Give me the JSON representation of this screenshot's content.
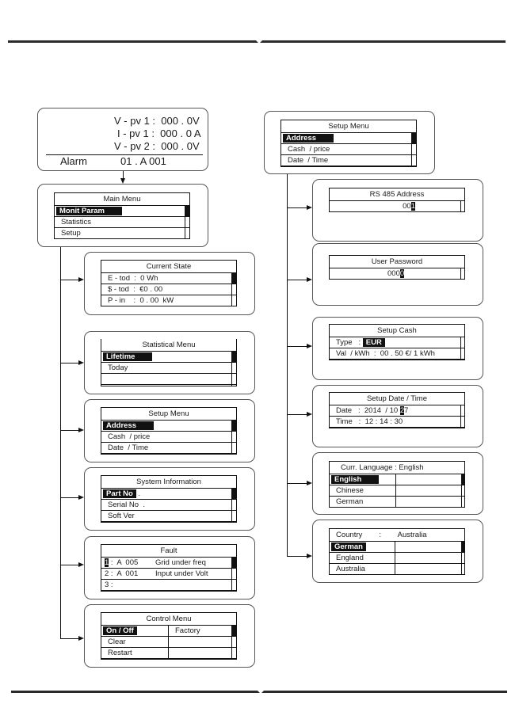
{
  "status_screen": {
    "lines": [
      "V - pv 1 :  000 . 0V",
      "I - pv 1 :  000 . 0 A",
      "V - pv 2 :  000 . 0V"
    ],
    "alarm_label": "Alarm",
    "alarm_value": "01 . A 001"
  },
  "main_menu": {
    "title": "Main Menu",
    "items": [
      "Monit Param",
      "Statistics",
      "Setup"
    ],
    "selected": 0
  },
  "current_state": {
    "title": "Current State",
    "rows": [
      "E - tod  :  0 Wh",
      "$ - tod  :  €0 . 00",
      "P - in    :  0 . 00  kW"
    ]
  },
  "statistical_menu": {
    "title": "Statistical Menu",
    "items": [
      "Lifetime",
      "Today",
      ""
    ]
  },
  "setup_menu_left": {
    "title": "Setup Menu",
    "items": [
      "Address",
      "Cash  / price",
      "Date  / Time"
    ]
  },
  "system_information": {
    "title": "System Information",
    "items": [
      "Part No",
      "Serial No  .",
      "Soft Ver"
    ],
    "selected_suffix": " ."
  },
  "fault": {
    "title": "Fault",
    "rows": [
      {
        "index": "1",
        "code": " :  A  005",
        "desc": "Grid under freq"
      },
      {
        "index": "2",
        "code": " :  A  001",
        "desc": "Input under Volt"
      },
      {
        "index": "3",
        "code": " :",
        "desc": ""
      }
    ]
  },
  "control_menu": {
    "title": "Control Menu",
    "col1": [
      "On / Off",
      "Clear",
      "Restart"
    ],
    "col2": [
      "Factory",
      "",
      ""
    ]
  },
  "setup_menu_right": {
    "title": "Setup Menu",
    "items": [
      "Address",
      "Cash  / price",
      "Date  / Time"
    ]
  },
  "rs485_address": {
    "title": "RS 485    Address",
    "value_prefix": "00",
    "value_cursor": "1"
  },
  "user_password": {
    "title": "User Password",
    "value_prefix": "000",
    "value_cursor": "0"
  },
  "setup_cash": {
    "title": "Setup Cash",
    "type_label": "Type   :",
    "type_value": "EUR",
    "val_row": "Val  / kWh  :  00 . 50 €/ 1 kWh"
  },
  "setup_date_time": {
    "title": "Setup Date     / Time",
    "date_prefix": "Date   :  2014  / 10 ",
    "date_cursor": "2",
    "date_suffix": "7",
    "time_row": "Time   :  12 : 14 : 30"
  },
  "language": {
    "title": "Curr.  Language : English",
    "items": [
      "English",
      "Chinese",
      "German"
    ]
  },
  "country": {
    "title": "Country        :        Australia",
    "items": [
      "German",
      "England",
      "Australia"
    ]
  },
  "colors": {
    "line": "#111111",
    "rule": "#2a2a2a",
    "panel_border": "#555555",
    "watermark": "#8c8cff"
  }
}
